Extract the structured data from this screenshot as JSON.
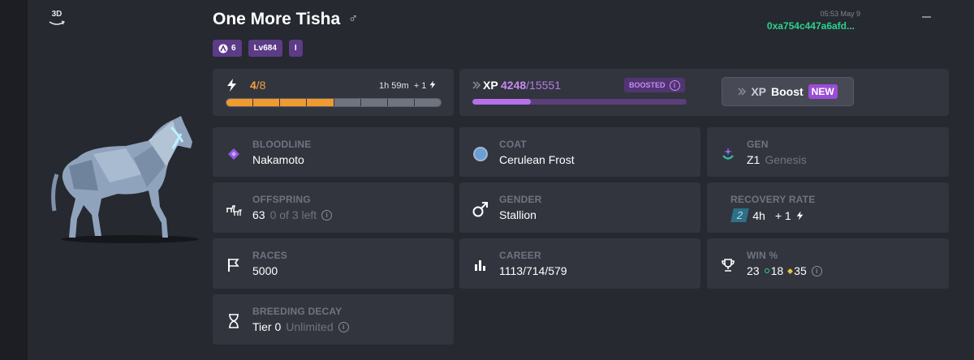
{
  "view3d": {
    "label": "3D"
  },
  "horse": {
    "name": "One More Tisha",
    "gender_symbol": "♂",
    "timestamp": "05:53 May 9",
    "owner_address": "0xa754c447a6afd...",
    "badges": {
      "rank_value": "6",
      "level": "Lv684",
      "tier": "I"
    }
  },
  "energy": {
    "current": "4",
    "max": "/8",
    "timer": "1h 59m",
    "regen": "+ 1",
    "segments_filled": 4,
    "segments_total": 8
  },
  "xp": {
    "label": "XP",
    "current": "4248",
    "total": "/15551",
    "boosted_label": "BOOSTED",
    "boost_button_label": "Boost",
    "boost_button_xp": "XP",
    "new_tag": "NEW",
    "progress_fraction": 0.2732
  },
  "stats": {
    "bloodline": {
      "label": "BLOODLINE",
      "value": "Nakamoto"
    },
    "coat": {
      "label": "COAT",
      "value": "Cerulean Frost",
      "color": "#6b9fd3"
    },
    "gen": {
      "label": "GEN",
      "value": "Z1",
      "sub": "Genesis"
    },
    "offspring": {
      "label": "OFFSPRING",
      "value": "63",
      "sub": "0 of 3 left"
    },
    "gender": {
      "label": "GENDER",
      "value": "Stallion"
    },
    "recovery": {
      "label": "RECOVERY RATE",
      "rate": "2",
      "time": "4h",
      "plus": "+ 1"
    },
    "races": {
      "label": "RACES",
      "value": "5000"
    },
    "career": {
      "label": "CAREER",
      "value": "1113/714/579"
    },
    "win": {
      "label": "WIN %",
      "value": "23",
      "second": "18",
      "third": "35"
    },
    "decay": {
      "label": "BREEDING DECAY",
      "value": "Tier 0",
      "sub": "Unlimited"
    }
  },
  "colors": {
    "accent_orange": "#f09a2f",
    "accent_purple": "#b670ee",
    "address_green": "#2bd38f",
    "panel": "#262930",
    "card": "#32353e"
  }
}
